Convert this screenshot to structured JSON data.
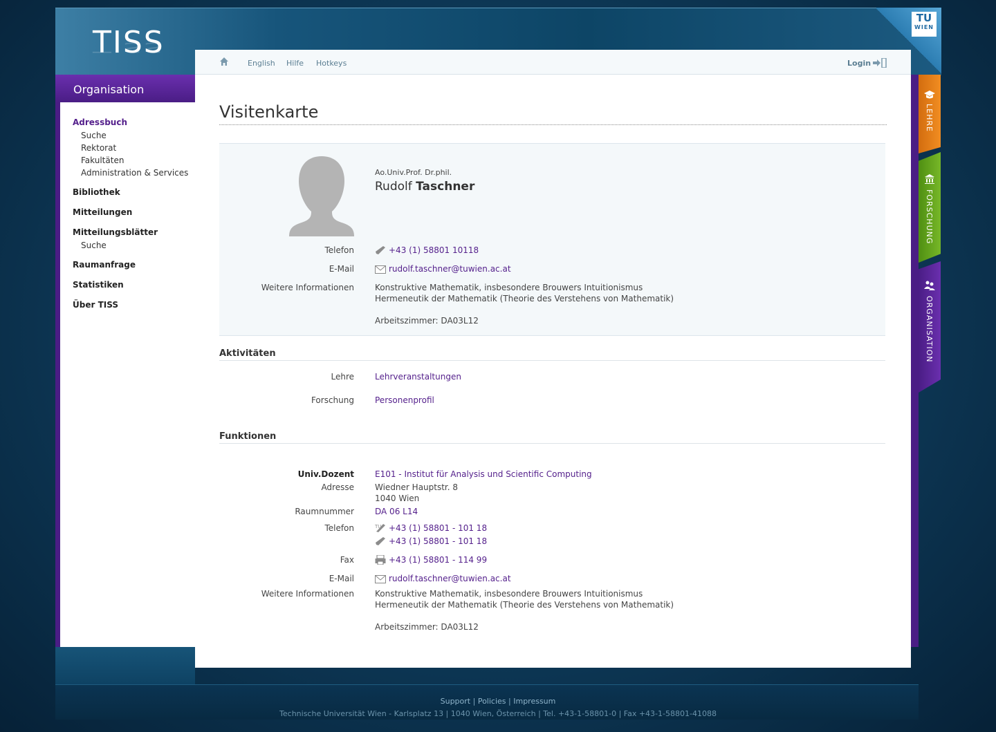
{
  "header": {
    "logo": "TISS",
    "tu_logo_top": "TU",
    "tu_logo_bottom": "WIEN"
  },
  "topnav": {
    "language": "English",
    "help": "Hilfe",
    "hotkeys": "Hotkeys",
    "login": "Login"
  },
  "sidebar": {
    "heading": "Organisation",
    "items": [
      {
        "label": "Adressbuch",
        "sub": [
          "Suche",
          "Rektorat",
          "Fakultäten",
          "Administration & Services"
        ]
      },
      {
        "label": "Bibliothek"
      },
      {
        "label": "Mitteilungen"
      },
      {
        "label": "Mitteilungsblätter",
        "sub": [
          "Suche"
        ]
      },
      {
        "label": "Raumanfrage"
      },
      {
        "label": "Statistiken"
      },
      {
        "label": "Über TISS"
      }
    ]
  },
  "right_tabs": [
    "LEHRE",
    "FORSCHUNG",
    "ORGANISATION"
  ],
  "page_title": "Visitenkarte",
  "card": {
    "title": "Ao.Univ.Prof. Dr.phil.",
    "first_name": "Rudolf",
    "last_name": "Taschner",
    "phone_label": "Telefon",
    "phone": "+43 (1) 58801 10118",
    "email_label": "E-Mail",
    "email": "rudolf.taschner@tuwien.ac.at",
    "info_label": "Weitere Informationen",
    "info_line1": "Konstruktive Mathematik, insbesondere Brouwers Intuitionismus",
    "info_line2": "Hermeneutik der Mathematik (Theorie des Verstehens von Mathematik)",
    "office": "Arbeitszimmer: DA03L12"
  },
  "activities": {
    "heading": "Aktivitäten",
    "teaching_label": "Lehre",
    "teaching_link": "Lehrveranstaltungen",
    "research_label": "Forschung",
    "research_link": "Personenprofil"
  },
  "functions": {
    "heading": "Funktionen",
    "role": "Univ.Dozent",
    "institute": "E101 - Institut für Analysis und Scientific Computing",
    "address_label": "Adresse",
    "address_line1": "Wiedner Hauptstr. 8",
    "address_line2": "1040 Wien",
    "room_label": "Raumnummer",
    "room": "DA 06 L14",
    "phone_label": "Telefon",
    "phone1": "+43 (1) 58801 - 101 18",
    "phone2": "+43 (1) 58801 - 101 18",
    "fax_label": "Fax",
    "fax": "+43 (1) 58801 - 114 99",
    "email_label": "E-Mail",
    "email": "rudolf.taschner@tuwien.ac.at",
    "info_label": "Weitere Informationen",
    "info_line1": "Konstruktive Mathematik, insbesondere Brouwers Intuitionismus",
    "info_line2": "Hermeneutik der Mathematik (Theorie des Verstehens von Mathematik)",
    "office": "Arbeitszimmer: DA03L12"
  },
  "footer": {
    "support": "Support",
    "policies": "Policies",
    "impressum": "Impressum",
    "separator": "|",
    "address": "Technische Universität Wien - Karlsplatz 13 | 1040 Wien, Österreich | Tel. +43-1-58801-0 | Fax +43-1-58801-41088"
  },
  "colors": {
    "accent_purple": "#55218c",
    "lehre_orange": "#f18d22",
    "forschung_green": "#77b728",
    "organisation_purple": "#4a1d85"
  }
}
